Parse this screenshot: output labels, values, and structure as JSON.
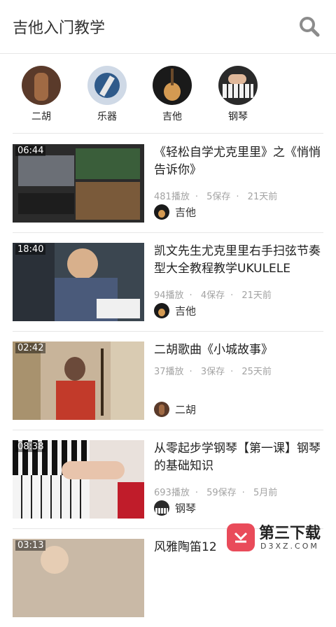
{
  "header": {
    "title": "吉他入门教学",
    "search_icon": "search-icon"
  },
  "categories": [
    {
      "label": "二胡",
      "icon": "erhu-avatar",
      "color": "#5a3a2a"
    },
    {
      "label": "乐器",
      "icon": "instrument-avatar",
      "color": "#2f5a8a"
    },
    {
      "label": "吉他",
      "icon": "guitar-avatar",
      "color": "#1a1a1a"
    },
    {
      "label": "钢琴",
      "icon": "piano-avatar",
      "color": "#2a2a2a"
    }
  ],
  "videos": [
    {
      "duration": "06:44",
      "title": "《轻松自学尤克里里》之《悄悄告诉你》",
      "plays": "481播放",
      "saves": "5保存",
      "time": "21天前",
      "category": "吉他",
      "thumb_color": "#2b2b2b"
    },
    {
      "duration": "18:40",
      "title": "凯文先生尤克里里右手扫弦节奏型大全教程教学UKULELE",
      "plays": "94播放",
      "saves": "4保存",
      "time": "21天前",
      "category": "吉他",
      "thumb_color": "#3b4650"
    },
    {
      "duration": "02:42",
      "title": "二胡歌曲《小城故事》",
      "plays": "37播放",
      "saves": "3保存",
      "time": "25天前",
      "category": "二胡",
      "thumb_color": "#8a6b4f"
    },
    {
      "duration": "08:38",
      "title": "从零起步学钢琴【第一课】钢琴的基础知识",
      "plays": "693播放",
      "saves": "59保存",
      "time": "5月前",
      "category": "钢琴",
      "thumb_color": "#3a2a26"
    },
    {
      "duration": "03:13",
      "title": "风雅陶笛12",
      "plays": "",
      "saves": "",
      "time": "",
      "category": "",
      "thumb_color": "#c9b9a6"
    }
  ],
  "watermark": {
    "text": "第三下载",
    "sub": "D3XZ.COM"
  }
}
